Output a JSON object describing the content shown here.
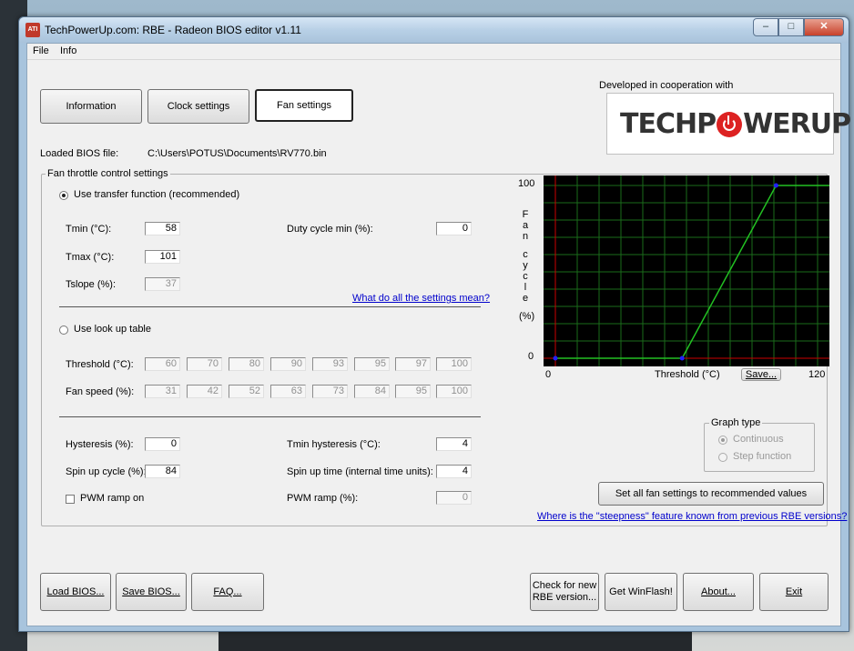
{
  "window": {
    "title": "TechPowerUp.com: RBE - Radeon BIOS editor v1.11",
    "app_icon_text": "ATI"
  },
  "menu": [
    "File",
    "Info"
  ],
  "tabs": {
    "information": "Information",
    "clock": "Clock settings",
    "fan": "Fan settings"
  },
  "cooperation": {
    "text": "Developed in cooperation with",
    "logo_left": "TECHP",
    "logo_right": "WERUP"
  },
  "bios": {
    "label": "Loaded BIOS file:",
    "path": "C:\\Users\\POTUS\\Documents\\RV770.bin"
  },
  "fan": {
    "group_title": "Fan throttle control settings",
    "transfer_label": "Use transfer function (recommended)",
    "tmin_label": "Tmin (°C):",
    "tmin": "58",
    "tmax_label": "Tmax (°C):",
    "tmax": "101",
    "tslope_label": "Tslope (%):",
    "tslope": "37",
    "duty_label": "Duty cycle min (%):",
    "duty": "0",
    "settings_link": "What do all the settings mean?",
    "lookup_label": "Use look up table",
    "threshold_label": "Threshold (°C):",
    "threshold": [
      "60",
      "70",
      "80",
      "90",
      "93",
      "95",
      "97",
      "100"
    ],
    "speed_label": "Fan speed (%):",
    "speed": [
      "31",
      "42",
      "52",
      "63",
      "73",
      "84",
      "95",
      "100"
    ],
    "hyst_label": "Hysteresis (%):",
    "hyst": "0",
    "tmin_hyst_label": "Tmin hysteresis (°C):",
    "tmin_hyst": "4",
    "spin_cycle_label": "Spin up cycle (%):",
    "spin_cycle": "84",
    "spin_time_label": "Spin up time (internal time units):",
    "spin_time": "4",
    "pwm_on_label": "PWM ramp on",
    "pwm_ramp_label": "PWM ramp (%):",
    "pwm_ramp": "0"
  },
  "graph": {
    "y_max": "100",
    "y_min": "0",
    "x_min": "0",
    "x_max": "120",
    "y_title": [
      "F",
      "a",
      "n",
      "",
      "c",
      "y",
      "c",
      "l",
      "e",
      "",
      "(%)"
    ],
    "x_title": "Threshold (°C)",
    "save": "Save...",
    "type_title": "Graph type",
    "continuous": "Continuous",
    "step": "Step function",
    "line_color": "#22c022",
    "grid_color": "#1a6b1a",
    "point_color": "#2222ff"
  },
  "chart_data": {
    "type": "line",
    "x": [
      0,
      58,
      101,
      120
    ],
    "y": [
      0,
      0,
      100,
      100
    ],
    "xlim": [
      0,
      120
    ],
    "ylim": [
      0,
      100
    ],
    "xlabel": "Threshold (°C)",
    "ylabel": "Fan cycle (%)"
  },
  "recommend_button": "Set all fan settings to recommended values",
  "steepness_link": "Where is the \"steepness\" feature known from previous RBE versions?",
  "bottom": {
    "load": "Load BIOS...",
    "save": "Save BIOS...",
    "faq": "FAQ...",
    "check1": "Check for new",
    "check2": "RBE version...",
    "winflash": "Get WinFlash!",
    "about": "About...",
    "exit": "Exit"
  }
}
